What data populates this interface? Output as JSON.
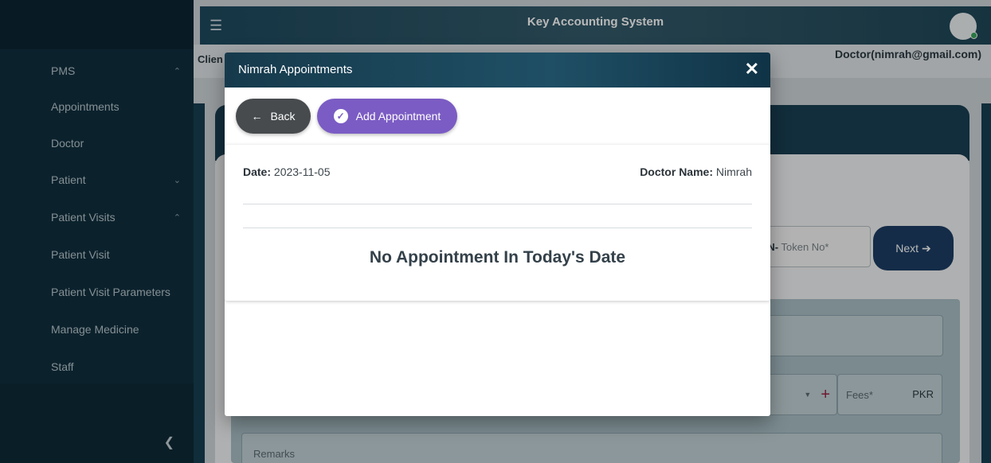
{
  "app": {
    "title": "Key Accounting System"
  },
  "sidebar": {
    "items": [
      {
        "label": "PMS",
        "chevron": "up"
      },
      {
        "label": "Appointments"
      },
      {
        "label": "Doctor"
      },
      {
        "label": "Patient",
        "chevron": "down"
      },
      {
        "label": "Patient Visits",
        "chevron": "up"
      },
      {
        "label": "Patient Visit"
      },
      {
        "label": "Patient Visit Parameters"
      },
      {
        "label": "Manage Medicine"
      },
      {
        "label": "Staff"
      }
    ],
    "collapse_icon": "chevron-left-icon"
  },
  "subbar": {
    "client_label": "Clien",
    "user_label": "Doctor(nimrah@gmail.com)"
  },
  "background_form": {
    "token_prefix": "KN-",
    "token_placeholder": "Token No*",
    "next_label": "Next",
    "fees_placeholder": "Fees*",
    "fees_unit": "PKR",
    "remarks_placeholder": "Remarks"
  },
  "modal": {
    "title": "Nimrah Appointments",
    "back_label": "Back",
    "add_label": "Add Appointment",
    "date_label": "Date:",
    "date_value": "2023-11-05",
    "doctor_label": "Doctor Name:",
    "doctor_value": "Nimrah",
    "empty_message": "No Appointment In Today's Date"
  },
  "colors": {
    "sidebar_bg": "#10303f",
    "header_bg": "#1f4f65",
    "add_button": "#7b5cc4",
    "back_button": "#474b4e",
    "next_button": "#1c3e64"
  }
}
